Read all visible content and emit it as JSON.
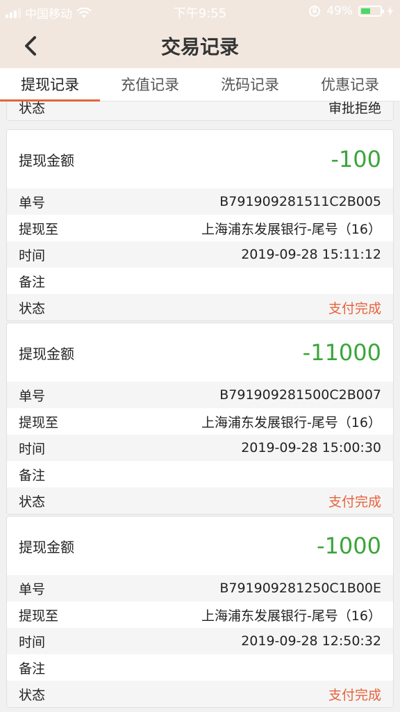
{
  "status_bar": {
    "carrier": "中国移动",
    "time": "下午9:55",
    "battery": "49%",
    "battery_level": 0.49
  },
  "nav": {
    "title": "交易记录"
  },
  "tabs": [
    {
      "label": "提现记录",
      "active": true
    },
    {
      "label": "充值记录",
      "active": false
    },
    {
      "label": "洗码记录",
      "active": false
    },
    {
      "label": "优惠记录",
      "active": false
    }
  ],
  "partial_row": {
    "label": "状态",
    "value": "审批拒绝"
  },
  "records": [
    {
      "amount_label": "提现金额",
      "amount": "-100",
      "order_label": "单号",
      "order": "B791909281511C2B005",
      "to_label": "提现至",
      "to": "上海浦东发展银行-尾号（16）",
      "time_label": "时间",
      "time": "2019-09-28 15:11:12",
      "note_label": "备注",
      "note": "",
      "status_label": "状态",
      "status": "支付完成"
    },
    {
      "amount_label": "提现金额",
      "amount": "-11000",
      "order_label": "单号",
      "order": "B791909281500C2B007",
      "to_label": "提现至",
      "to": "上海浦东发展银行-尾号（16）",
      "time_label": "时间",
      "time": "2019-09-28 15:00:30",
      "note_label": "备注",
      "note": "",
      "status_label": "状态",
      "status": "支付完成"
    },
    {
      "amount_label": "提现金额",
      "amount": "-1000",
      "order_label": "单号",
      "order": "B791909281250C1B00E",
      "to_label": "提现至",
      "to": "上海浦东发展银行-尾号（16）",
      "time_label": "时间",
      "time": "2019-09-28 12:50:32",
      "note_label": "备注",
      "note": "",
      "status_label": "状态",
      "status": "支付完成"
    }
  ],
  "colors": {
    "header_bg": "#f1e7df",
    "accent": "#e8623a",
    "amount_green": "#3aa53a",
    "status_orange": "#e8623a"
  }
}
